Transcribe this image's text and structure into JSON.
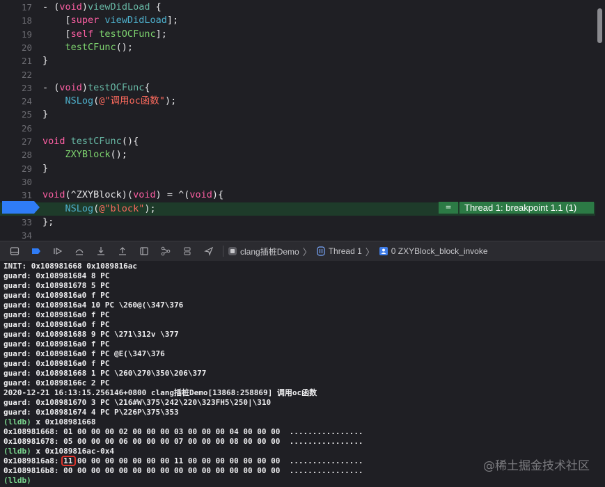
{
  "editor": {
    "lines": [
      {
        "n": "17",
        "segs": [
          [
            "plain",
            "- ("
          ],
          [
            "kw",
            "void"
          ],
          [
            "plain",
            ")"
          ],
          [
            "fn",
            "viewDidLoad"
          ],
          [
            "plain",
            " {"
          ]
        ]
      },
      {
        "n": "18",
        "segs": [
          [
            "plain",
            "    ["
          ],
          [
            "kw",
            "super"
          ],
          [
            "plain",
            " "
          ],
          [
            "mth",
            "viewDidLoad"
          ],
          [
            "plain",
            "];"
          ]
        ]
      },
      {
        "n": "19",
        "segs": [
          [
            "plain",
            "    ["
          ],
          [
            "kw",
            "self"
          ],
          [
            "plain",
            " "
          ],
          [
            "blk",
            "testOCFunc"
          ],
          [
            "plain",
            "];"
          ]
        ]
      },
      {
        "n": "20",
        "segs": [
          [
            "plain",
            "    "
          ],
          [
            "blk",
            "testCFunc"
          ],
          [
            "plain",
            "();"
          ]
        ]
      },
      {
        "n": "21",
        "segs": [
          [
            "plain",
            "}"
          ]
        ]
      },
      {
        "n": "22",
        "segs": []
      },
      {
        "n": "23",
        "segs": [
          [
            "plain",
            "- ("
          ],
          [
            "kw",
            "void"
          ],
          [
            "plain",
            ")"
          ],
          [
            "fn",
            "testOCFunc"
          ],
          [
            "plain",
            "{"
          ]
        ]
      },
      {
        "n": "24",
        "segs": [
          [
            "plain",
            "    "
          ],
          [
            "mth",
            "NSLog"
          ],
          [
            "plain",
            "("
          ],
          [
            "str",
            "@\"调用oc函数\""
          ],
          [
            "plain",
            ");"
          ]
        ]
      },
      {
        "n": "25",
        "segs": [
          [
            "plain",
            "}"
          ]
        ]
      },
      {
        "n": "26",
        "segs": []
      },
      {
        "n": "27",
        "segs": [
          [
            "kw",
            "void"
          ],
          [
            "plain",
            " "
          ],
          [
            "fn",
            "testCFunc"
          ],
          [
            "plain",
            "(){"
          ]
        ]
      },
      {
        "n": "28",
        "segs": [
          [
            "plain",
            "    "
          ],
          [
            "blk",
            "ZXYBlock"
          ],
          [
            "plain",
            "();"
          ]
        ]
      },
      {
        "n": "29",
        "segs": [
          [
            "plain",
            "}"
          ]
        ]
      },
      {
        "n": "30",
        "segs": []
      },
      {
        "n": "31",
        "segs": [
          [
            "kw",
            "void"
          ],
          [
            "plain",
            "(^ZXYBlock)("
          ],
          [
            "kw",
            "void"
          ],
          [
            "plain",
            ") = ^("
          ],
          [
            "kw",
            "void"
          ],
          [
            "plain",
            "){"
          ]
        ]
      },
      {
        "n": "32",
        "segs": [
          [
            "plain",
            "    "
          ],
          [
            "mth",
            "NSLog"
          ],
          [
            "plain",
            "("
          ],
          [
            "str",
            "@\"block\""
          ],
          [
            "plain",
            ");"
          ]
        ],
        "current": true
      },
      {
        "n": "33",
        "segs": [
          [
            "plain",
            "};"
          ]
        ]
      },
      {
        "n": "34",
        "segs": []
      }
    ],
    "breakpoint_label": "Thread 1: breakpoint 1.1 (1)",
    "breakpoint_eq": "="
  },
  "debugbar": {
    "crumbs": [
      "clang插桩Demo",
      "Thread 1",
      "0 ZXYBlock_block_invoke"
    ]
  },
  "console": {
    "lines": [
      {
        "t": "out",
        "text": "INIT: 0x108981668 0x1089816ac"
      },
      {
        "t": "out",
        "text": "guard: 0x108981684 8 PC"
      },
      {
        "t": "out",
        "text": "guard: 0x108981678 5 PC"
      },
      {
        "t": "out",
        "text": "guard: 0x1089816a0 f PC"
      },
      {
        "t": "out",
        "text": "guard: 0x1089816a4 10 PC \\260@(\\347\\376"
      },
      {
        "t": "out",
        "text": "guard: 0x1089816a0 f PC"
      },
      {
        "t": "out",
        "text": "guard: 0x1089816a0 f PC"
      },
      {
        "t": "out",
        "text": "guard: 0x108981688 9 PC \\271\\312v \\377"
      },
      {
        "t": "out",
        "text": "guard: 0x1089816a0 f PC"
      },
      {
        "t": "out",
        "text": "guard: 0x1089816a0 f PC @E(\\347\\376"
      },
      {
        "t": "out",
        "text": "guard: 0x1089816a0 f PC"
      },
      {
        "t": "out",
        "text": "guard: 0x108981668 1 PC \\260\\270\\350\\206\\377"
      },
      {
        "t": "out",
        "text": "guard: 0x10898166c 2 PC"
      },
      {
        "t": "out",
        "text": "2020-12-21 16:13:15.256146+0800 clang插桩Demo[13868:258869] 调用oc函数"
      },
      {
        "t": "out",
        "text": "guard: 0x108981670 3 PC \\216#W\\375\\242\\220\\323FH5\\250|\\310"
      },
      {
        "t": "out",
        "text": "guard: 0x108981674 4 PC P\\226P\\375\\353"
      },
      {
        "t": "prompt",
        "prompt": "(lldb)",
        "cmd": " x 0x108981668"
      },
      {
        "t": "out",
        "text": "0x108981668: 01 00 00 00 02 00 00 00 03 00 00 00 04 00 00 00  ................"
      },
      {
        "t": "out",
        "text": "0x108981678: 05 00 00 00 06 00 00 00 07 00 00 00 08 00 00 00  ................"
      },
      {
        "t": "prompt",
        "prompt": "(lldb)",
        "cmd": " x 0x1089816ac-0x4"
      },
      {
        "t": "out",
        "text": "0x1089816a8: 11 00 00 00 00 00 00 00 11 00 00 00 00 00 00 00  ................"
      },
      {
        "t": "out",
        "text": "0x1089816b8: 00 00 00 00 00 00 00 00 00 00 00 00 00 00 00 00  ................"
      },
      {
        "t": "prompt",
        "prompt": "(lldb)",
        "cmd": ""
      }
    ],
    "watermark": "@稀土掘金技术社区"
  }
}
